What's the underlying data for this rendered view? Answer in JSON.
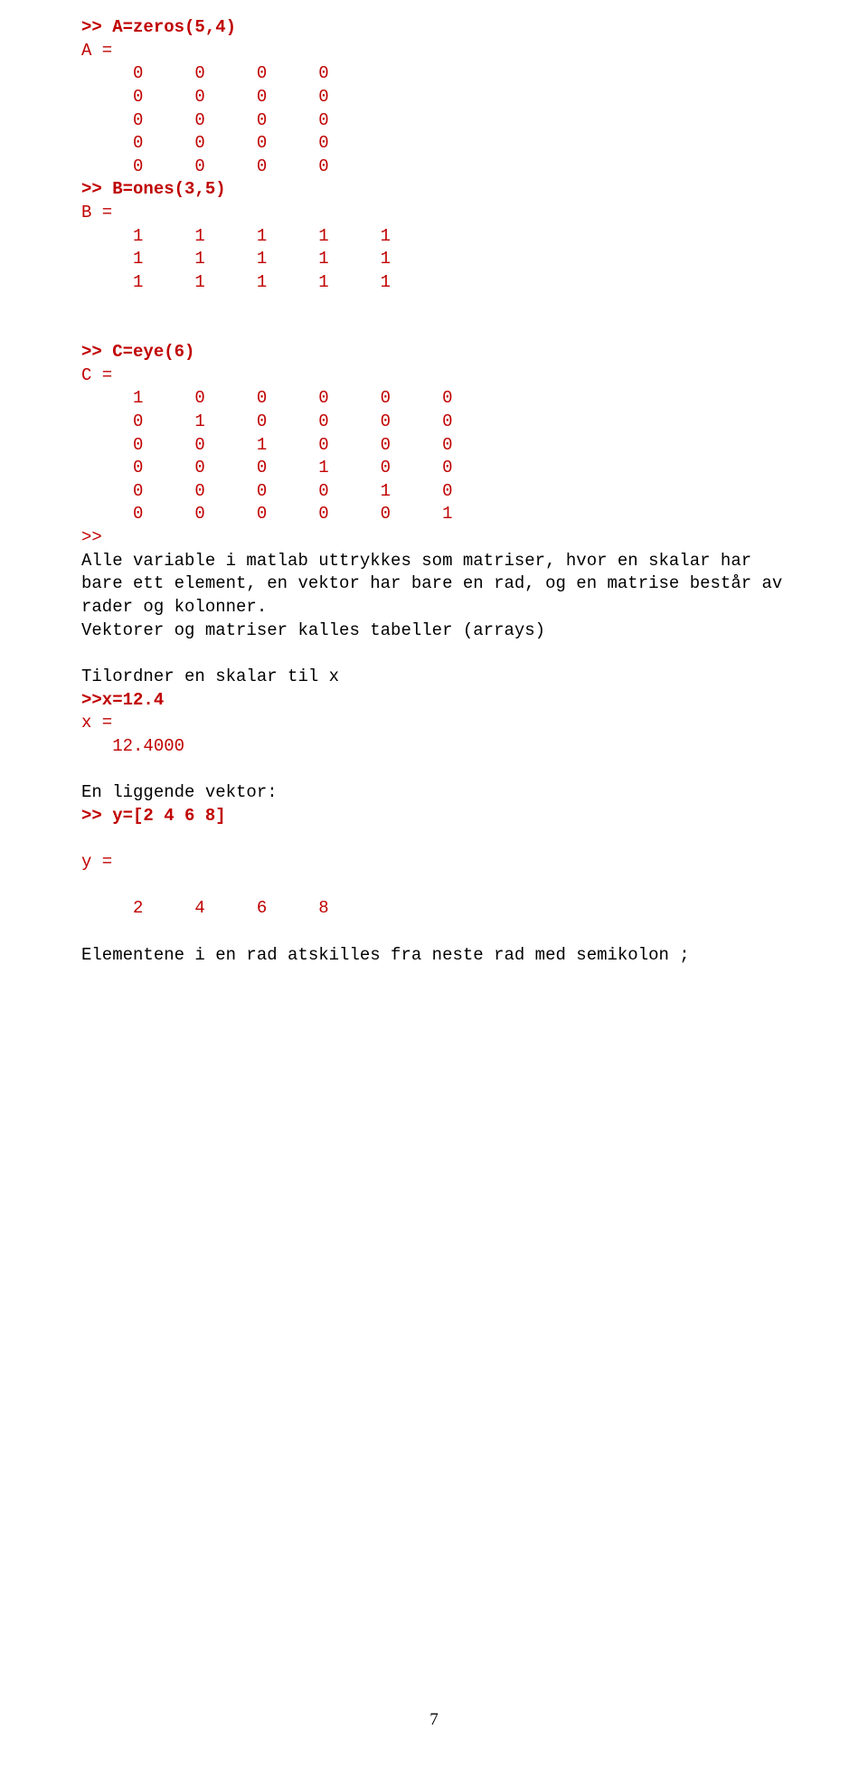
{
  "cmd1": ">> A=zeros(5,4)",
  "out_A_label": "A =",
  "out_A_rows": [
    "     0     0     0     0",
    "     0     0     0     0",
    "     0     0     0     0",
    "     0     0     0     0",
    "     0     0     0     0"
  ],
  "cmd2": ">> B=ones(3,5)",
  "out_B_label": "B =",
  "out_B_rows": [
    "     1     1     1     1     1",
    "     1     1     1     1     1",
    "     1     1     1     1     1"
  ],
  "cmd3": ">> C=eye(6)",
  "out_C_label": "C =",
  "out_C_rows": [
    "     1     0     0     0     0     0",
    "     0     1     0     0     0     0",
    "     0     0     1     0     0     0",
    "     0     0     0     1     0     0",
    "     0     0     0     0     1     0",
    "     0     0     0     0     0     1"
  ],
  "out_C_tail": ">>",
  "para1": "Alle variable i matlab uttrykkes som matriser, hvor en skalar har bare ett element, en vektor har bare en rad, og en matrise består av rader og kolonner.\nVektorer og matriser kalles tabeller (arrays)",
  "para2": "Tilordner en skalar til x",
  "cmd4": ">>x=12.4",
  "out_x_label": "x =",
  "out_x_val": "   12.4000",
  "para3": "En liggende vektor:",
  "cmd5": ">> y=[2 4 6 8]",
  "out_y_label": "y =",
  "out_y_val": "     2     4     6     8",
  "para4": "Elementene i en rad atskilles fra neste rad med semikolon ;",
  "page_number": "7"
}
